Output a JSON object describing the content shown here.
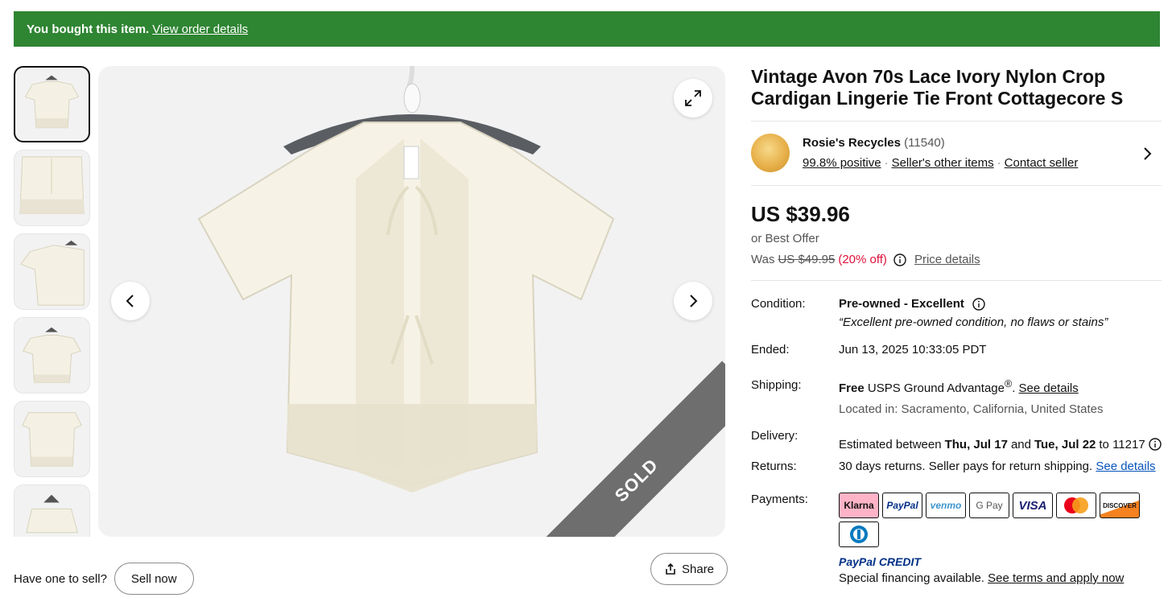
{
  "banner": {
    "bold": "You bought this item.",
    "link": "View order details"
  },
  "gallery": {
    "sold_label": "SOLD"
  },
  "sell": {
    "prompt": "Have one to sell?",
    "button": "Sell now"
  },
  "share": {
    "label": "Share"
  },
  "item": {
    "title": "Vintage Avon 70s Lace Ivory Nylon Crop Cardigan Lingerie Tie Front Cottagecore S"
  },
  "seller": {
    "name": "Rosie's Recycles",
    "feedback_count": "(11540)",
    "positive": "99.8% positive",
    "other_items": "Seller's other items",
    "contact": "Contact seller"
  },
  "price": {
    "current": "US $39.96",
    "offer": "or Best Offer",
    "was_label": "Was",
    "was_value": "US $49.95",
    "discount": "(20% off)",
    "details_link": "Price details"
  },
  "details": {
    "condition_label": "Condition:",
    "condition_value": "Pre-owned - Excellent",
    "condition_note": "“Excellent pre-owned condition, no flaws or stains”",
    "ended_label": "Ended:",
    "ended_value": "Jun 13, 2025 10:33:05 PDT",
    "shipping_label": "Shipping:",
    "shipping_free": "Free",
    "shipping_service": "USPS Ground Advantage",
    "shipping_reg": "®",
    "shipping_link": "See details",
    "location": "Located in: Sacramento, California, United States",
    "delivery_label": "Delivery:",
    "delivery_prefix": "Estimated between",
    "delivery_start": "Thu, Jul 17",
    "delivery_and": "and",
    "delivery_end": "Tue, Jul 22",
    "delivery_to": "to 11217",
    "returns_label": "Returns:",
    "returns_value": "30 days returns. Seller pays for return shipping.",
    "returns_link": "See details",
    "payments_label": "Payments:",
    "payment_methods": [
      "Klarna",
      "PayPal",
      "venmo",
      "G Pay",
      "VISA",
      "Mastercard",
      "DISCOVER",
      "Diners Club"
    ],
    "paypal_credit": "PayPal CREDIT",
    "financing_text": "Special financing available.",
    "financing_link": "See terms and apply now"
  },
  "colors": {
    "banner_green": "#2e8532",
    "discount_red": "#e0103a",
    "link_blue": "#0654ba",
    "klarna_pink": "#ffb3c7"
  }
}
